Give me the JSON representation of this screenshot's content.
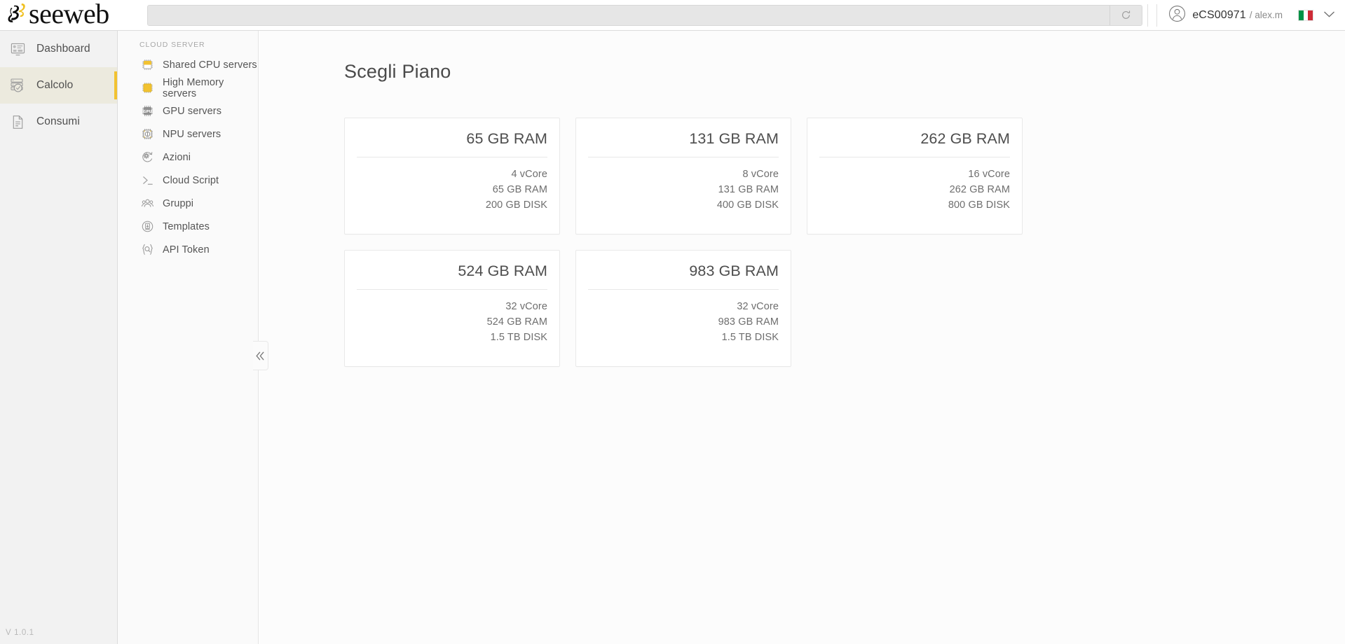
{
  "brand": {
    "logo_word": "seeweb",
    "logo_mark_icon": "seeweb-3-mark-icon"
  },
  "topbar": {
    "search_value": "",
    "search_placeholder": "",
    "refresh_icon": "refresh-icon",
    "avatar_icon": "user-avatar-icon",
    "account_name": "eCS00971",
    "account_sub": "/ alex.m",
    "flag_icon": "italy-flag-icon",
    "flag_colors": [
      "#009246",
      "#ffffff",
      "#ce2b37"
    ],
    "lang_caret_icon": "chevron-down-icon"
  },
  "sidebar": {
    "version": "V 1.0.1",
    "active_accent": "#f2c230",
    "items": [
      {
        "label": "Dashboard",
        "icon": "dashboard-monitor-icon",
        "active": false
      },
      {
        "label": "Calcolo",
        "icon": "server-stack-check-icon",
        "active": true
      },
      {
        "label": "Consumi",
        "icon": "document-lines-icon",
        "active": false
      }
    ]
  },
  "submenu": {
    "title": "CLOUD SERVER",
    "collapse_icon": "double-chevron-left-icon",
    "items": [
      {
        "label": "Shared CPU servers",
        "icon": "cpu-chip-half-icon"
      },
      {
        "label": "High Memory servers",
        "icon": "cpu-chip-full-icon"
      },
      {
        "label": "GPU servers",
        "icon": "gpu-chip-icon"
      },
      {
        "label": "NPU servers",
        "icon": "npu-chip-icon"
      },
      {
        "label": "Azioni",
        "icon": "actions-gear-refresh-icon"
      },
      {
        "label": "Cloud Script",
        "icon": "terminal-prompt-icon"
      },
      {
        "label": "Gruppi",
        "icon": "users-group-icon"
      },
      {
        "label": "Templates",
        "icon": "template-stack-icon"
      },
      {
        "label": "API Token",
        "icon": "api-token-key-icon"
      }
    ]
  },
  "main": {
    "page_title": "Scegli Piano",
    "plans": [
      {
        "title": "65 GB RAM",
        "cpu": "4 vCore",
        "ram": "65 GB RAM",
        "disk": "200 GB DISK"
      },
      {
        "title": "131 GB RAM",
        "cpu": "8 vCore",
        "ram": "131 GB RAM",
        "disk": "400 GB DISK"
      },
      {
        "title": "262 GB RAM",
        "cpu": "16 vCore",
        "ram": "262 GB RAM",
        "disk": "800 GB DISK"
      },
      {
        "title": "524 GB RAM",
        "cpu": "32 vCore",
        "ram": "524 GB RAM",
        "disk": "1.5 TB DISK"
      },
      {
        "title": "983 GB RAM",
        "cpu": "32 vCore",
        "ram": "983 GB RAM",
        "disk": "1.5 TB DISK"
      }
    ]
  }
}
